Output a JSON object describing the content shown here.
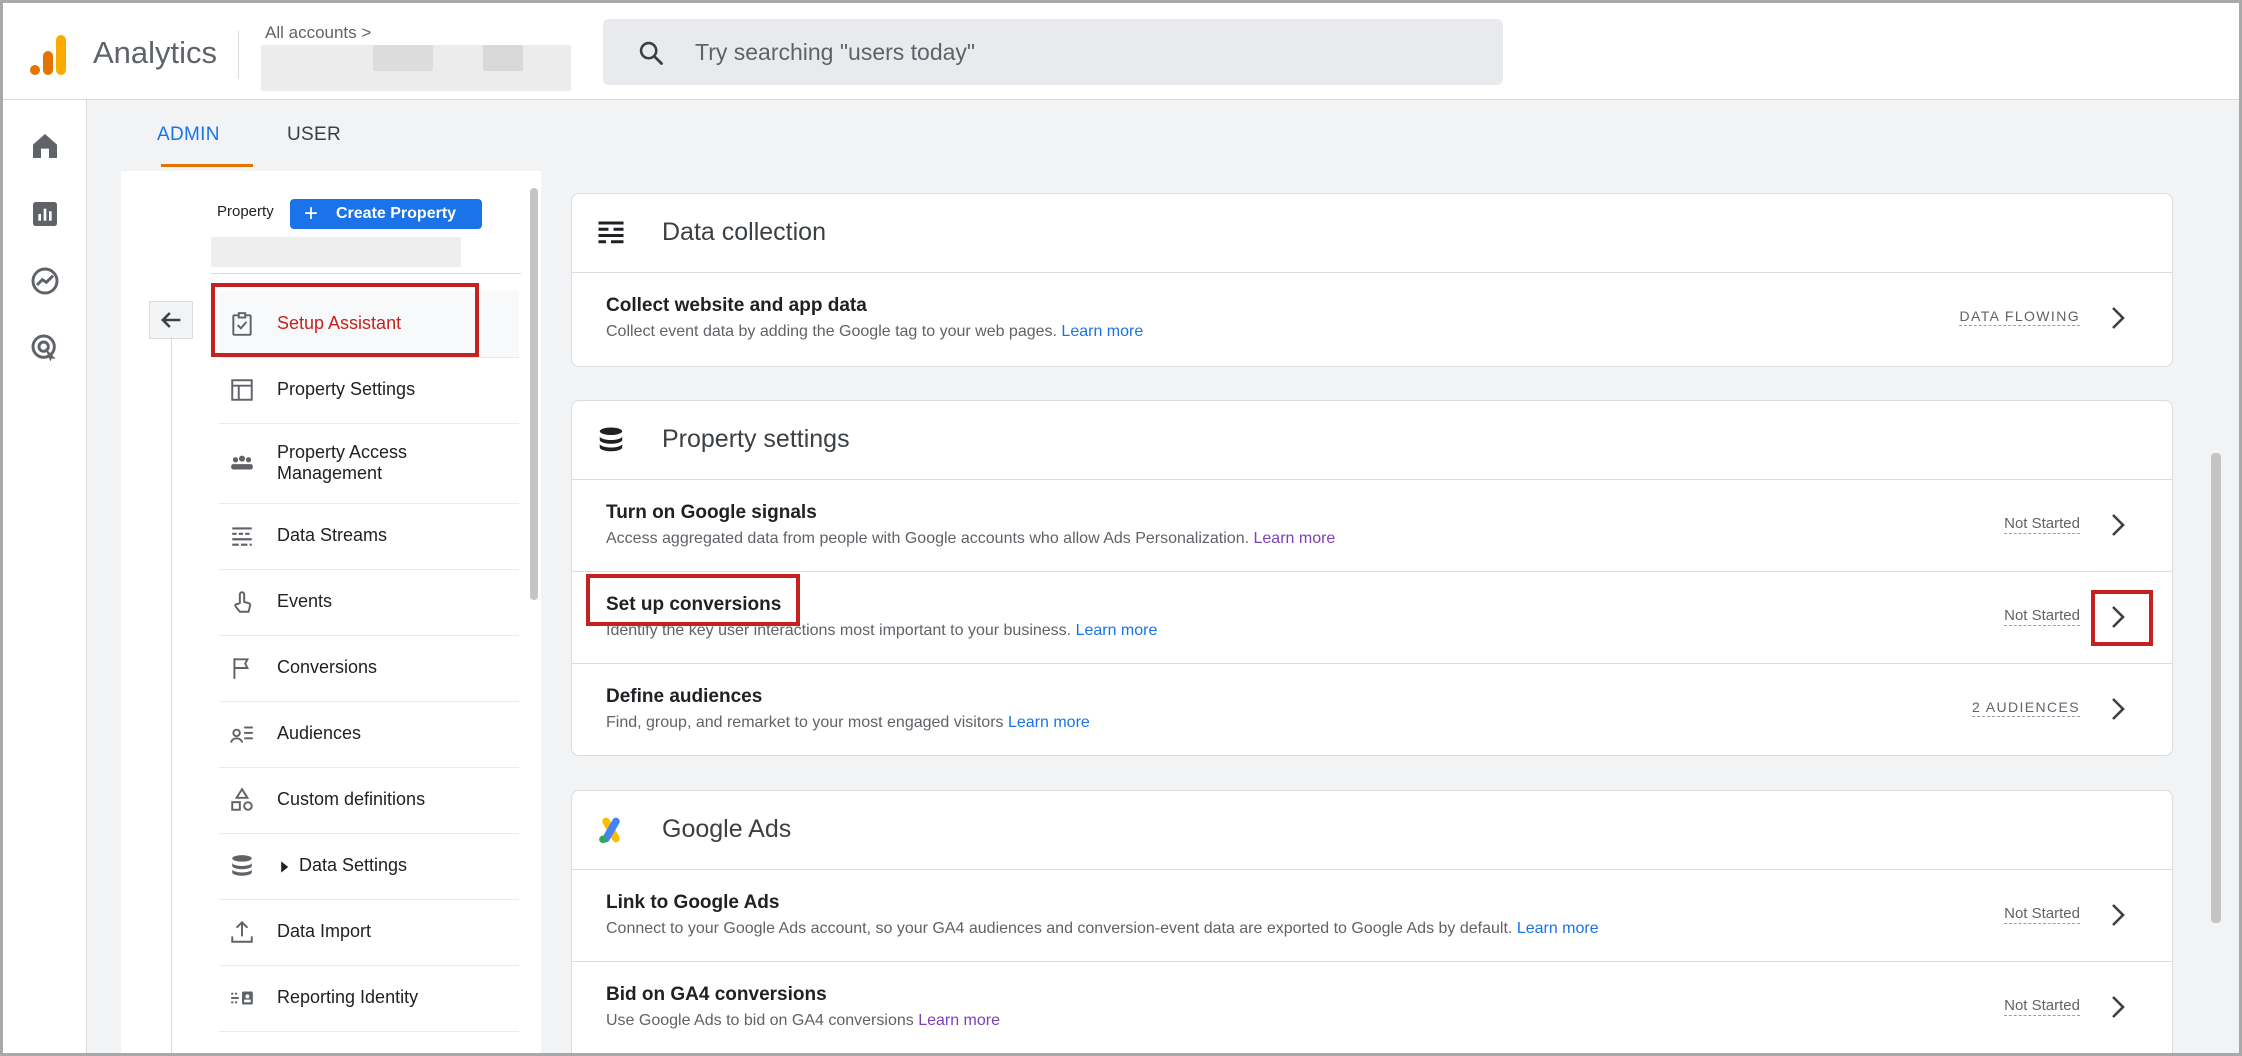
{
  "app": {
    "title": "Analytics",
    "breadcrumb": "All accounts >"
  },
  "search": {
    "placeholder": "Try searching \"users today\""
  },
  "rail": {
    "icons": [
      "home-icon",
      "reports-icon",
      "explore-icon",
      "advertising-icon"
    ]
  },
  "tabs": [
    {
      "label": "ADMIN",
      "active": true
    },
    {
      "label": "USER",
      "active": false
    }
  ],
  "property": {
    "label": "Property",
    "create_button": "Create Property"
  },
  "nav": [
    {
      "label": "Setup Assistant",
      "icon": "clipboard-check-icon",
      "active": true
    },
    {
      "label": "Property Settings",
      "icon": "settings-layout-icon"
    },
    {
      "label": "Property Access\nManagement",
      "icon": "people-icon"
    },
    {
      "label": "Data Streams",
      "icon": "streams-icon"
    },
    {
      "label": "Events",
      "icon": "touch-icon"
    },
    {
      "label": "Conversions",
      "icon": "flag-icon"
    },
    {
      "label": "Audiences",
      "icon": "audience-icon"
    },
    {
      "label": "Custom definitions",
      "icon": "shapes-icon"
    },
    {
      "label": "Data Settings",
      "icon": "database-icon",
      "expandable": true
    },
    {
      "label": "Data Import",
      "icon": "upload-icon"
    },
    {
      "label": "Reporting Identity",
      "icon": "identity-icon"
    }
  ],
  "cards": [
    {
      "title": "Data collection",
      "icon": "data-collection-icon",
      "rows": [
        {
          "title": "Collect website and app data",
          "desc": "Collect event data by adding the Google tag to your web pages.",
          "link": "Learn more",
          "status": "DATA FLOWING",
          "caps": true
        }
      ]
    },
    {
      "title": "Property settings",
      "icon": "database-icon",
      "rows": [
        {
          "title": "Turn on Google signals",
          "desc": "Access aggregated data from people with Google accounts who allow Ads Personalization.",
          "link": "Learn more",
          "status": "Not Started"
        },
        {
          "title": "Set up conversions",
          "desc": "Identify the key user interactions most important to your business.",
          "link": "Learn more",
          "status": "Not Started"
        },
        {
          "title": "Define audiences",
          "desc": "Find, group, and remarket to your most engaged visitors",
          "link": "Learn more",
          "status": "2 AUDIENCES",
          "caps": true
        }
      ]
    },
    {
      "title": "Google Ads",
      "icon": "google-ads-icon",
      "rows": [
        {
          "title": "Link to Google Ads",
          "desc": "Connect to your Google Ads account, so your GA4 audiences and conversion-event data are exported to Google Ads by default.",
          "link": "Learn more",
          "status": "Not Started"
        },
        {
          "title": "Bid on GA4 conversions",
          "desc": "Use Google Ads to bid on GA4 conversions",
          "link": "Learn more",
          "status": "Not Started"
        }
      ]
    }
  ],
  "colors": {
    "accent": "#1a73e8",
    "highlight": "#c5221f",
    "tab_underline": "#e37400"
  }
}
